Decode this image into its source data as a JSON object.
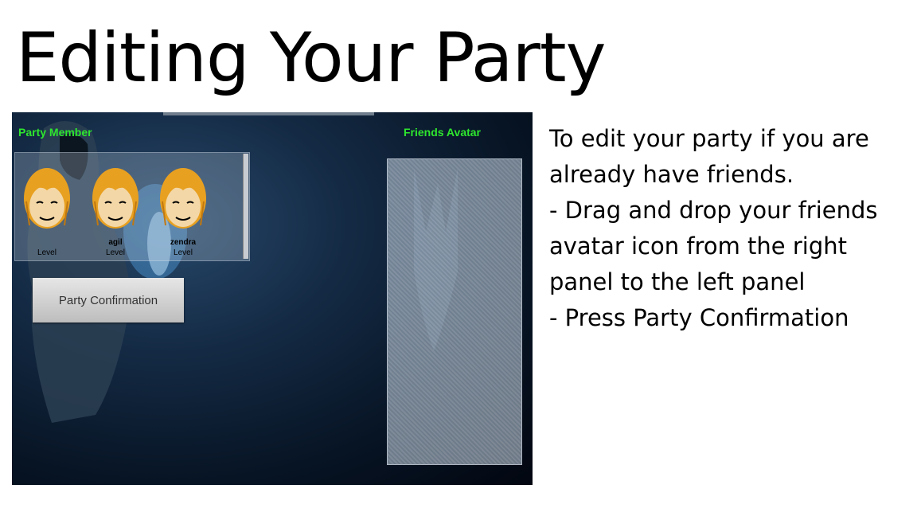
{
  "slide": {
    "title": "Editing Your Party",
    "instructions": [
      "To edit your party if you are",
      "already have friends.",
      "- Drag and drop  your friends",
      "avatar icon from the right",
      "panel to the left panel",
      "- Press Party Confirmation"
    ]
  },
  "game": {
    "party_label": "Party Member",
    "friends_label": "Friends Avatar",
    "confirm_button": "Party Confirmation",
    "party_members": [
      {
        "name": "",
        "level": "Level"
      },
      {
        "name": "agil",
        "level": "Level"
      },
      {
        "name": "zendra",
        "level": "Level"
      }
    ],
    "colors": {
      "label_green": "#2ee62e",
      "hair": "#e8a020",
      "skin": "#f3d7a6"
    }
  }
}
